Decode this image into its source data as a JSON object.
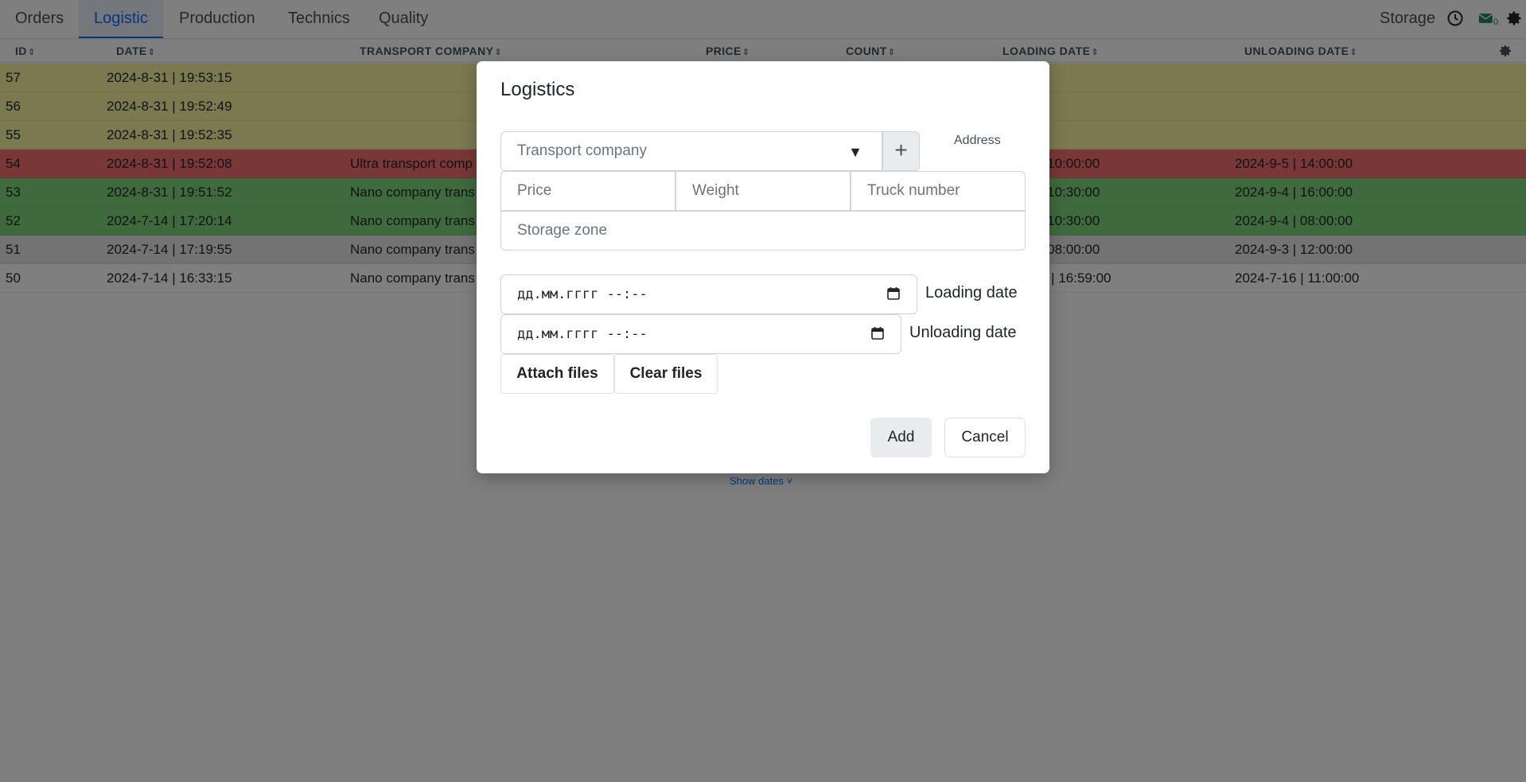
{
  "nav": {
    "tabs": [
      "Orders",
      "Logistic",
      "Production",
      "Technics",
      "Quality"
    ],
    "active_tab": "Logistic",
    "right_label": "Storage",
    "mail_count": "0"
  },
  "table": {
    "headers": [
      "ID",
      "DATE",
      "TRANSPORT COMPANY",
      "PRICE",
      "COUNT",
      "LOADING DATE",
      "UNLOADING DATE"
    ],
    "rows": [
      {
        "id": "57",
        "date": "2024-8-31 | 19:53:15",
        "company": "",
        "loading": "",
        "unloading": "",
        "color": "#f5f3a1"
      },
      {
        "id": "56",
        "date": "2024-8-31 | 19:52:49",
        "company": "",
        "loading": "",
        "unloading": "",
        "color": "#f5f3a1"
      },
      {
        "id": "55",
        "date": "2024-8-31 | 19:52:35",
        "company": "",
        "loading": "",
        "unloading": "",
        "color": "#f5f3a1"
      },
      {
        "id": "54",
        "date": "2024-8-31 | 19:52:08",
        "company": "Ultra transport comp",
        "loading": "| 10:00:00",
        "unloading": "2024-9-5 | 14:00:00",
        "color": "#f26f6f"
      },
      {
        "id": "53",
        "date": "2024-8-31 | 19:51:52",
        "company": "Nano company trans",
        "loading": "| 10:30:00",
        "unloading": "2024-9-4 | 16:00:00",
        "color": "#7fd47c"
      },
      {
        "id": "52",
        "date": "2024-7-14 | 17:20:14",
        "company": "Nano company trans",
        "loading": "| 10:30:00",
        "unloading": "2024-9-4 | 08:00:00",
        "color": "#7fd47c"
      },
      {
        "id": "51",
        "date": "2024-7-14 | 17:19:55",
        "company": "Nano company trans",
        "loading": "| 08:00:00",
        "unloading": "2024-9-3 | 12:00:00",
        "color": "#e6e6e6"
      },
      {
        "id": "50",
        "date": "2024-7-14 | 16:33:15",
        "company": "Nano company trans",
        "loading": "5 | 16:59:00",
        "unloading": "2024-7-16 | 11:00:00",
        "color": "#ffffff"
      }
    ],
    "show_dates": "Show dates"
  },
  "modal": {
    "title": "Logistics",
    "transport_placeholder": "Transport company",
    "address_label": "Address",
    "price_placeholder": "Price",
    "weight_placeholder": "Weight",
    "truck_placeholder": "Truck number",
    "storage_placeholder": "Storage zone",
    "date_placeholder": "дд.мм.гггг --:--",
    "loading_label": "Loading date",
    "unloading_label": "Unloading date",
    "attach_label": "Attach files",
    "clear_label": "Clear files",
    "add_label": "Add",
    "cancel_label": "Cancel"
  }
}
